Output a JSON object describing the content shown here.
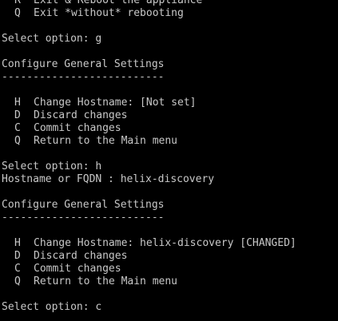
{
  "terminal": {
    "foreground": "#c8c8c8",
    "background": "#000000",
    "top_items": [
      {
        "key": "R",
        "label": "Exit & Reboot the appliance"
      },
      {
        "key": "Q",
        "label": "Exit *without* rebooting"
      }
    ],
    "prompt1": {
      "prompt": "Select option:",
      "input": "g"
    },
    "section1": {
      "title": "Configure General Settings",
      "rule": "--------------------------",
      "items": [
        {
          "key": "H",
          "label": "Change Hostname: [Not set]"
        },
        {
          "key": "D",
          "label": "Discard changes"
        },
        {
          "key": "C",
          "label": "Commit changes"
        },
        {
          "key": "Q",
          "label": "Return to the Main menu"
        }
      ]
    },
    "prompt2": {
      "prompt": "Select option:",
      "input": "h"
    },
    "hostname_prompt": {
      "prompt": "Hostname or FQDN :",
      "input": "helix-discovery"
    },
    "section2": {
      "title": "Configure General Settings",
      "rule": "--------------------------",
      "items": [
        {
          "key": "H",
          "label": "Change Hostname: helix-discovery [CHANGED]"
        },
        {
          "key": "D",
          "label": "Discard changes"
        },
        {
          "key": "C",
          "label": "Commit changes"
        },
        {
          "key": "Q",
          "label": "Return to the Main menu"
        }
      ]
    },
    "prompt3": {
      "prompt": "Select option:",
      "input": "c"
    }
  }
}
